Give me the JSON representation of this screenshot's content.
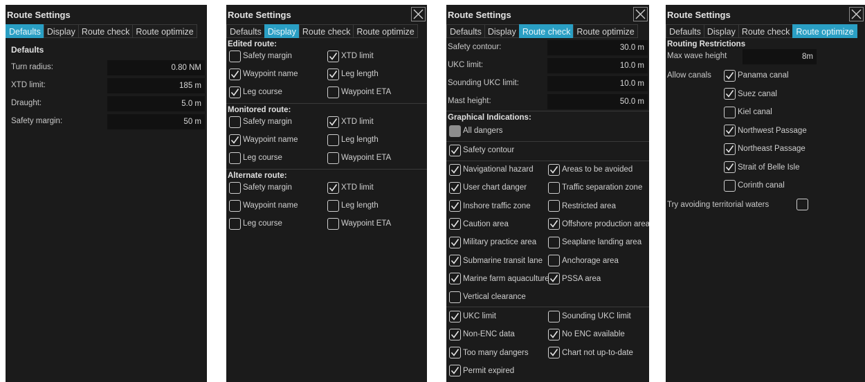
{
  "common": {
    "title": "Route Settings",
    "tabs": [
      "Defaults",
      "Display",
      "Route check",
      "Route optimize"
    ]
  },
  "defaults": {
    "section": "Defaults",
    "fields": [
      {
        "label": "Turn radius:",
        "value": "0.80 NM"
      },
      {
        "label": "XTD limit:",
        "value": "185 m"
      },
      {
        "label": "Draught:",
        "value": "5.0 m"
      },
      {
        "label": "Safety margin:",
        "value": "50 m"
      }
    ]
  },
  "display": {
    "groups": [
      {
        "title": "Edited route:",
        "items": [
          {
            "label": "Safety margin",
            "checked": false
          },
          {
            "label": "XTD limit",
            "checked": true
          },
          {
            "label": "Waypoint name",
            "checked": true
          },
          {
            "label": "Leg length",
            "checked": true
          },
          {
            "label": "Leg course",
            "checked": true
          },
          {
            "label": "Waypoint ETA",
            "checked": false
          }
        ]
      },
      {
        "title": "Monitored route:",
        "items": [
          {
            "label": "Safety margin",
            "checked": false
          },
          {
            "label": "XTD limit",
            "checked": true
          },
          {
            "label": "Waypoint name",
            "checked": true
          },
          {
            "label": "Leg length",
            "checked": false
          },
          {
            "label": "Leg course",
            "checked": false
          },
          {
            "label": "Waypoint ETA",
            "checked": false
          }
        ]
      },
      {
        "title": "Alternate route:",
        "items": [
          {
            "label": "Safety margin",
            "checked": false
          },
          {
            "label": "XTD limit",
            "checked": true
          },
          {
            "label": "Waypoint name",
            "checked": false
          },
          {
            "label": "Leg length",
            "checked": false
          },
          {
            "label": "Leg course",
            "checked": false
          },
          {
            "label": "Waypoint ETA",
            "checked": false
          }
        ]
      }
    ]
  },
  "route_check": {
    "fields": [
      {
        "label": "Safety contour:",
        "value": "30.0 m"
      },
      {
        "label": "UKC limit:",
        "value": "10.0 m"
      },
      {
        "label": "Sounding UKC limit:",
        "value": "10.0 m"
      },
      {
        "label": "Mast height:",
        "value": "50.0 m"
      }
    ],
    "graphical_title": "Graphical Indications:",
    "all_dangers": {
      "label": "All dangers",
      "state": "partial"
    },
    "safety_contour": {
      "label": "Safety contour",
      "checked": true
    },
    "indications": [
      {
        "label": "Navigational hazard",
        "checked": true
      },
      {
        "label": "Areas to be avoided",
        "checked": true
      },
      {
        "label": "User chart danger",
        "checked": true
      },
      {
        "label": "Traffic separation zone",
        "checked": false
      },
      {
        "label": "Inshore traffic zone",
        "checked": true
      },
      {
        "label": "Restricted area",
        "checked": false
      },
      {
        "label": "Caution area",
        "checked": true
      },
      {
        "label": "Offshore production area",
        "checked": true
      },
      {
        "label": "Military practice area",
        "checked": true
      },
      {
        "label": "Seaplane landing area",
        "checked": false
      },
      {
        "label": "Submarine transit lane",
        "checked": true
      },
      {
        "label": "Anchorage area",
        "checked": false
      },
      {
        "label": "Marine farm aquaculture",
        "checked": true
      },
      {
        "label": "PSSA area",
        "checked": true
      },
      {
        "label": "Vertical clearance",
        "checked": false
      }
    ],
    "other": [
      {
        "label": "UKC limit",
        "checked": true
      },
      {
        "label": "Sounding UKC limit",
        "checked": false
      },
      {
        "label": "Non-ENC data",
        "checked": true
      },
      {
        "label": "No ENC available",
        "checked": true
      },
      {
        "label": "Too many dangers",
        "checked": true
      },
      {
        "label": "Chart not up-to-date",
        "checked": true
      },
      {
        "label": "Permit expired",
        "checked": true
      }
    ]
  },
  "route_optimize": {
    "section": "Routing Restrictions",
    "max_wave_label": "Max wave height",
    "max_wave_value": "8m",
    "allow_canals_label": "Allow canals",
    "canals": [
      {
        "label": "Panama canal",
        "checked": true
      },
      {
        "label": "Suez canal",
        "checked": true
      },
      {
        "label": "Kiel canal",
        "checked": false
      },
      {
        "label": "Northwest Passage",
        "checked": true
      },
      {
        "label": "Northeast Passage",
        "checked": true
      },
      {
        "label": "Strait of Belle Isle",
        "checked": true
      },
      {
        "label": "Corinth canal",
        "checked": false
      }
    ],
    "territorial": {
      "label": "Try avoiding territorial waters",
      "checked": false
    }
  },
  "colors": {
    "panel_bg": "#1b1b1b",
    "tab_active": "#2a9fc4",
    "field_bg": "#111111"
  }
}
